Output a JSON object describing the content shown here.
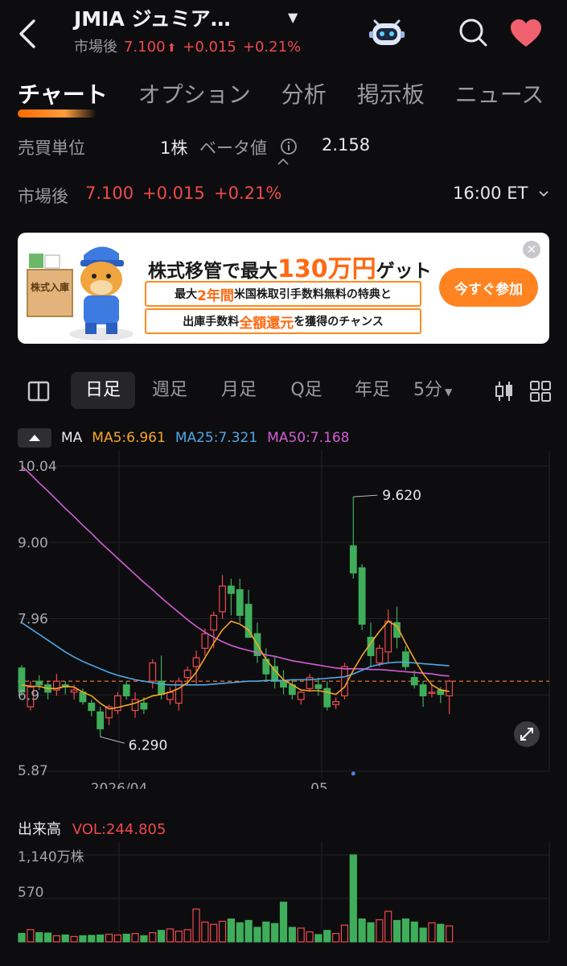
{
  "header": {
    "title": "JMIA ジュミア…",
    "session": "市場後",
    "price": "7.100",
    "arrow": "⬆",
    "change": "+0.015",
    "change_pct": "+0.21%"
  },
  "tabs": [
    "チャート",
    "オプション",
    "分析",
    "掲示板",
    "ニュース"
  ],
  "info": {
    "lot_label": "売買単位",
    "lot_value": "1株",
    "beta_label": "ベータ値",
    "beta_value": "2.158",
    "session_label": "市場後",
    "price": "7.100",
    "change": "+0.015",
    "change_pct": "+0.21%",
    "time": "16:00 ET"
  },
  "banner": {
    "line1_pre": "株式移管で最大",
    "line1_amount": "130万円",
    "line1_post": "ゲット",
    "line2_pre": "最大",
    "line2_highlight": "2年間",
    "line2_post": "米国株取引手数料無料の特典と",
    "line3_pre": "出庫手数料",
    "line3_highlight": "全額還元",
    "line3_post": "を獲得のチャンス",
    "mascot_label": "株式入庫",
    "button": "今すぐ参加"
  },
  "periods": [
    "日足",
    "週足",
    "月足",
    "Q足",
    "年足",
    "5分"
  ],
  "ma_legend": {
    "label": "MA",
    "ma5": "MA5:6.961",
    "ma25": "MA25:7.321",
    "ma50": "MA50:7.168"
  },
  "colors": {
    "up": "#f0494d",
    "down": "#3fae5b",
    "ma5": "#f5a623",
    "ma25": "#4fa8e8",
    "ma50": "#d35cd6",
    "accent": "#ff6a00"
  },
  "chart_data": {
    "type": "candlestick",
    "y_tick_labels": [
      "10.04",
      "9.00",
      "7.96",
      "6.9",
      "5.87"
    ],
    "x_tick_labels": [
      "2026/04",
      "05"
    ],
    "max_label": "9.620",
    "min_label": "6.290",
    "last_price_line": 7.1,
    "ylim": [
      5.87,
      10.04
    ],
    "candles": [
      {
        "o": 7.28,
        "h": 7.32,
        "l": 6.9,
        "c": 6.95
      },
      {
        "o": 6.75,
        "h": 7.1,
        "l": 6.7,
        "c": 7.02
      },
      {
        "o": 7.1,
        "h": 7.18,
        "l": 6.98,
        "c": 7.05
      },
      {
        "o": 7.05,
        "h": 7.1,
        "l": 6.85,
        "c": 6.95
      },
      {
        "o": 6.98,
        "h": 7.2,
        "l": 6.9,
        "c": 7.1
      },
      {
        "o": 7.05,
        "h": 7.1,
        "l": 6.92,
        "c": 7.02
      },
      {
        "o": 6.95,
        "h": 7.05,
        "l": 6.85,
        "c": 6.98
      },
      {
        "o": 6.95,
        "h": 7.0,
        "l": 6.78,
        "c": 6.82
      },
      {
        "o": 6.8,
        "h": 6.85,
        "l": 6.62,
        "c": 6.7
      },
      {
        "o": 6.68,
        "h": 6.75,
        "l": 6.34,
        "c": 6.45
      },
      {
        "o": 6.6,
        "h": 6.78,
        "l": 6.5,
        "c": 6.75
      },
      {
        "o": 6.7,
        "h": 6.95,
        "l": 6.65,
        "c": 6.9
      },
      {
        "o": 7.05,
        "h": 7.1,
        "l": 6.85,
        "c": 6.9
      },
      {
        "o": 6.7,
        "h": 6.95,
        "l": 6.6,
        "c": 6.85
      },
      {
        "o": 6.8,
        "h": 6.88,
        "l": 6.65,
        "c": 6.72
      },
      {
        "o": 7.1,
        "h": 7.4,
        "l": 7.0,
        "c": 7.35
      },
      {
        "o": 7.1,
        "h": 7.45,
        "l": 6.85,
        "c": 6.92
      },
      {
        "o": 6.85,
        "h": 7.02,
        "l": 6.78,
        "c": 6.95
      },
      {
        "o": 6.8,
        "h": 7.15,
        "l": 6.7,
        "c": 7.1
      },
      {
        "o": 7.15,
        "h": 7.3,
        "l": 7.05,
        "c": 7.25
      },
      {
        "o": 7.3,
        "h": 7.52,
        "l": 7.05,
        "c": 7.42
      },
      {
        "o": 7.55,
        "h": 7.82,
        "l": 7.45,
        "c": 7.75
      },
      {
        "o": 7.8,
        "h": 8.05,
        "l": 7.55,
        "c": 8.0
      },
      {
        "o": 8.05,
        "h": 8.55,
        "l": 7.95,
        "c": 8.4
      },
      {
        "o": 8.4,
        "h": 8.5,
        "l": 8.0,
        "c": 8.3
      },
      {
        "o": 8.35,
        "h": 8.5,
        "l": 7.9,
        "c": 8.0
      },
      {
        "o": 8.15,
        "h": 8.35,
        "l": 7.7,
        "c": 7.7
      },
      {
        "o": 7.75,
        "h": 7.9,
        "l": 7.35,
        "c": 7.45
      },
      {
        "o": 7.4,
        "h": 7.55,
        "l": 7.1,
        "c": 7.2
      },
      {
        "o": 7.3,
        "h": 7.45,
        "l": 7.0,
        "c": 7.1
      },
      {
        "o": 7.1,
        "h": 7.25,
        "l": 6.92,
        "c": 7.02
      },
      {
        "o": 7.05,
        "h": 7.12,
        "l": 6.85,
        "c": 6.92
      },
      {
        "o": 6.85,
        "h": 6.98,
        "l": 6.78,
        "c": 6.95
      },
      {
        "o": 7.0,
        "h": 7.2,
        "l": 6.95,
        "c": 7.15
      },
      {
        "o": 7.05,
        "h": 7.15,
        "l": 6.9,
        "c": 7.0
      },
      {
        "o": 7.0,
        "h": 7.1,
        "l": 6.7,
        "c": 6.75
      },
      {
        "o": 6.78,
        "h": 6.88,
        "l": 6.72,
        "c": 6.82
      },
      {
        "o": 6.9,
        "h": 7.35,
        "l": 6.85,
        "c": 7.3
      },
      {
        "o": 8.95,
        "h": 9.62,
        "l": 8.5,
        "c": 8.58
      },
      {
        "o": 8.65,
        "h": 8.7,
        "l": 7.8,
        "c": 7.88
      },
      {
        "o": 7.7,
        "h": 7.9,
        "l": 7.3,
        "c": 7.45
      },
      {
        "o": 7.35,
        "h": 7.6,
        "l": 7.3,
        "c": 7.55
      },
      {
        "o": 7.5,
        "h": 8.08,
        "l": 7.35,
        "c": 7.92
      },
      {
        "o": 7.9,
        "h": 8.12,
        "l": 7.55,
        "c": 7.7
      },
      {
        "o": 7.5,
        "h": 7.58,
        "l": 7.25,
        "c": 7.3
      },
      {
        "o": 7.15,
        "h": 7.25,
        "l": 7.0,
        "c": 7.05
      },
      {
        "o": 7.05,
        "h": 7.1,
        "l": 6.75,
        "c": 6.9
      },
      {
        "o": 6.95,
        "h": 7.05,
        "l": 6.88,
        "c": 6.95
      },
      {
        "o": 6.98,
        "h": 7.02,
        "l": 6.8,
        "c": 6.92
      },
      {
        "o": 6.9,
        "h": 7.12,
        "l": 6.65,
        "c": 7.1
      }
    ],
    "ma5": [
      7.05,
      7.03,
      7.03,
      7.0,
      7.0,
      7.03,
      7.02,
      6.95,
      6.9,
      6.8,
      6.72,
      6.74,
      6.77,
      6.8,
      6.85,
      6.9,
      6.92,
      6.95,
      7.0,
      7.08,
      7.22,
      7.42,
      7.62,
      7.8,
      7.92,
      7.88,
      7.8,
      7.6,
      7.4,
      7.25,
      7.12,
      7.05,
      6.98,
      6.97,
      6.97,
      6.95,
      6.92,
      7.02,
      7.25,
      7.45,
      7.62,
      7.78,
      7.92,
      7.85,
      7.62,
      7.4,
      7.2,
      7.05,
      6.98,
      6.96
    ],
    "ma25": [
      7.9,
      7.82,
      7.74,
      7.66,
      7.58,
      7.5,
      7.43,
      7.37,
      7.32,
      7.27,
      7.22,
      7.18,
      7.15,
      7.12,
      7.1,
      7.08,
      7.06,
      7.05,
      7.05,
      7.05,
      7.05,
      7.05,
      7.06,
      7.07,
      7.08,
      7.09,
      7.1,
      7.1,
      7.11,
      7.11,
      7.11,
      7.12,
      7.12,
      7.12,
      7.13,
      7.14,
      7.15,
      7.16,
      7.2,
      7.25,
      7.3,
      7.33,
      7.35,
      7.36,
      7.36,
      7.35,
      7.34,
      7.33,
      7.32,
      7.31
    ],
    "ma50": [
      10.04,
      9.93,
      9.81,
      9.7,
      9.58,
      9.46,
      9.35,
      9.23,
      9.12,
      9.0,
      8.89,
      8.78,
      8.67,
      8.56,
      8.45,
      8.35,
      8.24,
      8.14,
      8.04,
      7.94,
      7.85,
      7.77,
      7.7,
      7.64,
      7.59,
      7.55,
      7.52,
      7.49,
      7.46,
      7.44,
      7.41,
      7.38,
      7.36,
      7.34,
      7.32,
      7.3,
      7.28,
      7.27,
      7.27,
      7.27,
      7.26,
      7.26,
      7.25,
      7.24,
      7.23,
      7.22,
      7.21,
      7.2,
      7.18,
      7.17
    ],
    "volume": {
      "label": "出来高",
      "value_label": "VOL:244.805",
      "y_tick_labels": [
        "1,140万株",
        "570"
      ],
      "ylim": [
        0,
        1140
      ],
      "values": [
        110,
        160,
        120,
        115,
        80,
        90,
        70,
        80,
        85,
        90,
        100,
        90,
        100,
        110,
        80,
        120,
        150,
        170,
        140,
        160,
        430,
        260,
        230,
        270,
        300,
        250,
        280,
        190,
        260,
        240,
        520,
        190,
        180,
        130,
        95,
        150,
        110,
        220,
        1140,
        300,
        250,
        290,
        400,
        280,
        300,
        260,
        180,
        250,
        230,
        210
      ]
    }
  }
}
